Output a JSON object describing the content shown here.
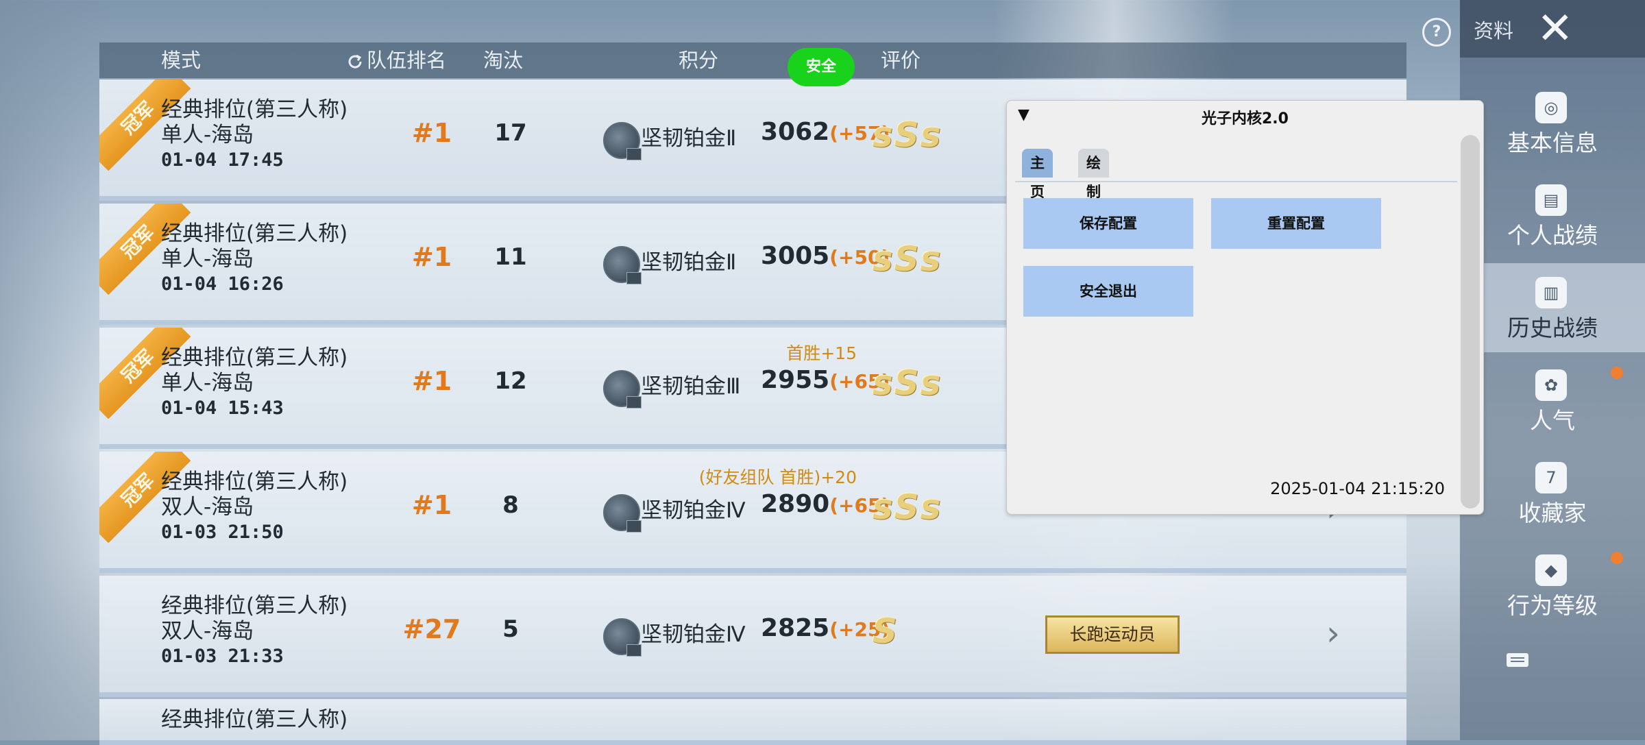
{
  "header": {
    "mode": "模式",
    "team_rank": "队伍排名",
    "eliminations": "淘汰",
    "score": "积分",
    "safe_badge": "安全",
    "rating": "评价"
  },
  "matches": [
    {
      "ribbon": "冠军",
      "mode": "经典排位(第三人称)",
      "map": "单人-海岛",
      "time": "01-04 17:45",
      "rank": "#1",
      "elims": "17",
      "tier": "坚韧铂金Ⅱ",
      "score": "3062",
      "delta": "(+57)",
      "bonus": "",
      "rating": "sSs",
      "tag": ""
    },
    {
      "ribbon": "冠军",
      "mode": "经典排位(第三人称)",
      "map": "单人-海岛",
      "time": "01-04 16:26",
      "rank": "#1",
      "elims": "11",
      "tier": "坚韧铂金Ⅱ",
      "score": "3005",
      "delta": "(+50)",
      "bonus": "",
      "rating": "sSs",
      "tag": ""
    },
    {
      "ribbon": "冠军",
      "mode": "经典排位(第三人称)",
      "map": "单人-海岛",
      "time": "01-04 15:43",
      "rank": "#1",
      "elims": "12",
      "tier": "坚韧铂金Ⅲ",
      "score": "2955",
      "delta": "(+65)",
      "bonus": "首胜+15",
      "rating": "sSs",
      "tag": ""
    },
    {
      "ribbon": "冠军",
      "mode": "经典排位(第三人称)",
      "map": "双人-海岛",
      "time": "01-03 21:50",
      "rank": "#1",
      "elims": "8",
      "tier": "坚韧铂金Ⅳ",
      "score": "2890",
      "delta": "(+65)",
      "bonus": "(好友组队 首胜)+20",
      "rating": "sSs",
      "tag": ""
    },
    {
      "ribbon": "",
      "mode": "经典排位(第三人称)",
      "map": "双人-海岛",
      "time": "01-03 21:33",
      "rank": "#27",
      "elims": "5",
      "tier": "坚韧铂金Ⅳ",
      "score": "2825",
      "delta": "(+25)",
      "bonus": "",
      "rating": "S",
      "tag": "长跑运动员"
    }
  ],
  "partial_row": {
    "mode": "经典排位(第三人称)"
  },
  "top": {
    "profile_label": "资料",
    "help": "?",
    "close": "✕"
  },
  "nav": [
    {
      "label": "基本信息",
      "icon": "profile-icon",
      "glyph": "◎"
    },
    {
      "label": "个人战绩",
      "icon": "stats-icon",
      "glyph": "▤"
    },
    {
      "label": "历史战绩",
      "icon": "history-icon",
      "glyph": "▥"
    },
    {
      "label": "人气",
      "icon": "popularity-icon",
      "glyph": "✿"
    },
    {
      "label": "收藏家",
      "icon": "collector-icon",
      "glyph": "7"
    },
    {
      "label": "行为等级",
      "icon": "behavior-icon",
      "glyph": "◆"
    }
  ],
  "dialog": {
    "collapse": "▼",
    "title": "光子内核2.0",
    "tabs": [
      "主页",
      "绘制"
    ],
    "buttons": {
      "save": "保存配置",
      "reset": "重置配置",
      "exit": "安全退出"
    },
    "timestamp": "2025-01-04 21:15:20"
  },
  "colors": {
    "accent_orange": "#e07a1c",
    "safe_green": "#19d21b",
    "dialog_button": "#a9c9f2",
    "active_tab": "#8fb2dc"
  }
}
